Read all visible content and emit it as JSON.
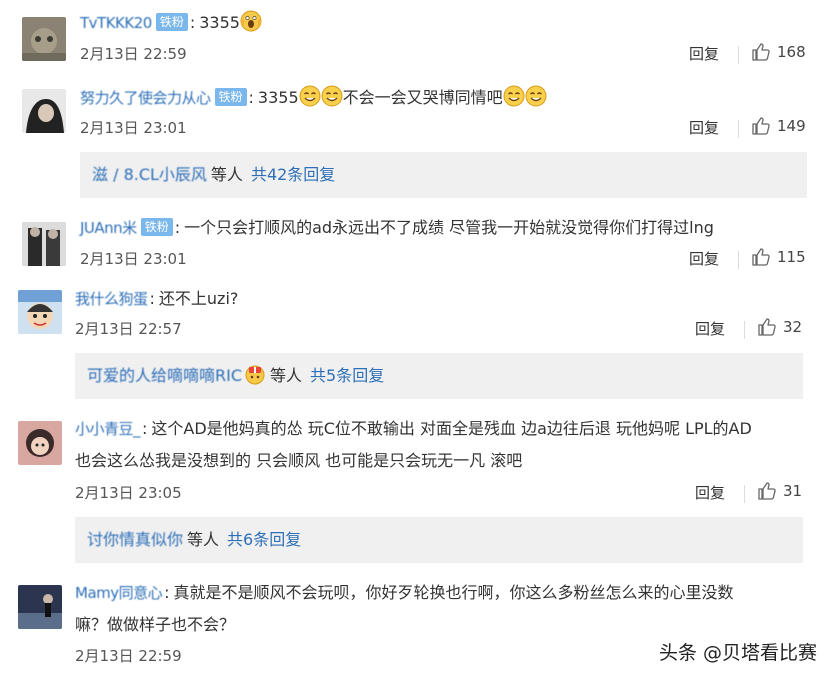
{
  "comments": [
    {
      "username": "TvTKKK20",
      "badge": "铁粉",
      "text": "3355",
      "time": "2月13日 22:59",
      "reply_label": "回复",
      "likes": "168"
    },
    {
      "username": "努力久了使会力从心",
      "badge": "铁粉",
      "text_a": "3355",
      "text_b": "不会一会又哭博同情吧",
      "time": "2月13日 23:01",
      "reply_label": "回复",
      "likes": "149",
      "sub": {
        "names": "滋 / 8.CL小辰风",
        "etc": "等人",
        "total": "共42条回复"
      }
    },
    {
      "username": "JUAnn米",
      "badge": "铁粉",
      "text": "一个只会打顺风的ad永远出不了成绩 尽管我一开始就没觉得你们打得过lng",
      "time": "2月13日 23:01",
      "reply_label": "回复",
      "likes": "115"
    },
    {
      "username": "我什么狗蛋",
      "text": "还不上uzi?",
      "time": "2月13日 22:57",
      "reply_label": "回复",
      "likes": "32",
      "sub": {
        "names": "可爱的人给嘀嘀嘀RIC",
        "etc": "等人",
        "total": "共5条回复"
      }
    },
    {
      "username": "小小青豆_",
      "text_line1": "这个AD是他妈真的怂 玩C位不敢输出 对面全是残血 边a边往后退 玩他妈呢 LPL的AD",
      "text_line2": "也会这么怂我是没想到的 只会顺风 也可能是只会玩无一凡 滚吧",
      "time": "2月13日 23:05",
      "reply_label": "回复",
      "likes": "31",
      "sub": {
        "names": "讨你情真似你",
        "etc": "等人",
        "total": "共6条回复"
      }
    },
    {
      "username": "Mamy同意心",
      "text_line1": "真就是不是顺风不会玩呗，你好歹轮换也行啊，你这么多粉丝怎么来的心里没数",
      "text_line2": "嘛？做做样子也不会？",
      "time": "2月13日 22:59"
    }
  ],
  "watermark": "头条 @贝塔看比赛",
  "colors": {
    "link": "#2d6fb8",
    "badge": "#7ab7ec",
    "subbox": "#f0f0f0"
  },
  "icons": [
    "avatar",
    "scream-emoji",
    "smile-emoji",
    "thumbs-up-icon",
    "gift-emoji"
  ]
}
